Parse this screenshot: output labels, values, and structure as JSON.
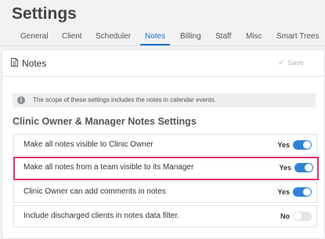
{
  "page": {
    "title": "Settings"
  },
  "tabs": [
    {
      "label": "General",
      "active": false
    },
    {
      "label": "Client",
      "active": false
    },
    {
      "label": "Scheduler",
      "active": false
    },
    {
      "label": "Notes",
      "active": true
    },
    {
      "label": "Billing",
      "active": false
    },
    {
      "label": "Staff",
      "active": false
    },
    {
      "label": "Misc",
      "active": false
    },
    {
      "label": "Smart Trees",
      "active": false
    }
  ],
  "card": {
    "title": "Notes",
    "title_icon": "document-icon",
    "save_label": "Save",
    "save_icon": "checkmark-icon",
    "save_enabled": false
  },
  "info": {
    "icon": "info-icon",
    "text": "The scope of these settings includes the notes in calendar events."
  },
  "section": {
    "title": "Clinic Owner & Manager Notes Settings",
    "rows": [
      {
        "label": "Make all notes visible to Clinic Owner",
        "state": "Yes",
        "on": true,
        "highlighted": false
      },
      {
        "label": "Make all notes from a team visible to its Manager",
        "state": "Yes",
        "on": true,
        "highlighted": true
      },
      {
        "label": "Clinic Owner can add comments in notes",
        "state": "Yes",
        "on": true,
        "highlighted": false
      },
      {
        "label": "Include discharged clients in notes data filter.",
        "state": "No",
        "on": false,
        "highlighted": false
      }
    ]
  },
  "colors": {
    "accent": "#2f83d6",
    "highlight": "#e0336e",
    "active_tab": "#1a73c8"
  }
}
